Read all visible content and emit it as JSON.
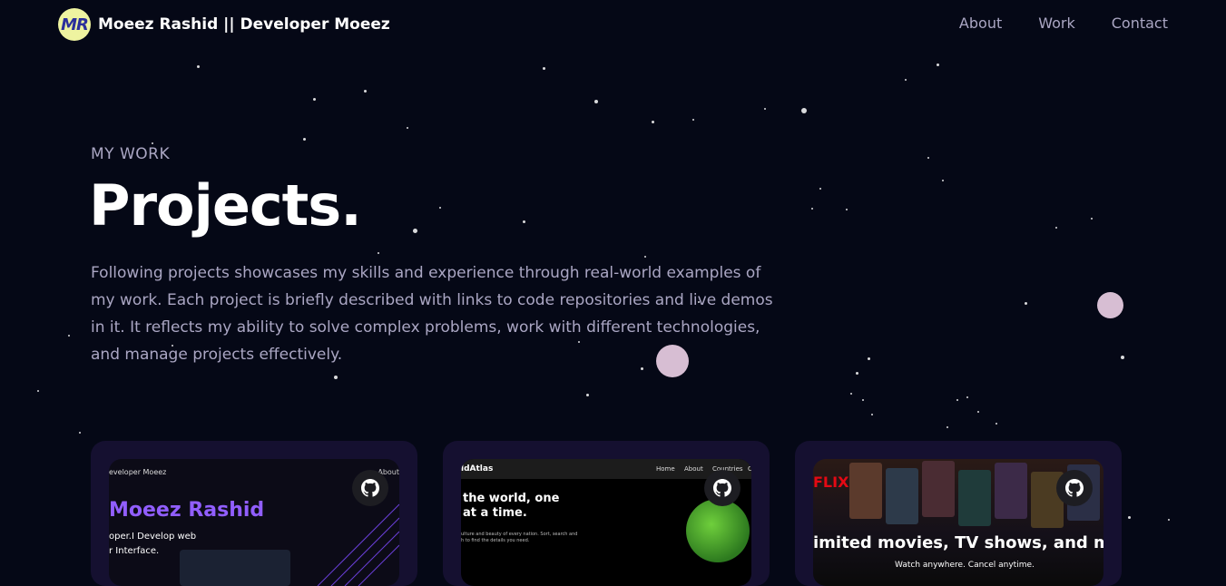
{
  "nav": {
    "logo_text": "MR",
    "brand": "Moeez Rashid || Developer Moeez",
    "links": [
      "About",
      "Work",
      "Contact"
    ]
  },
  "hero": {
    "kicker": "MY WORK",
    "title": "Projects.",
    "description": "Following projects showcases my skills and experience through real-world examples of my work. Each project is briefly described with links to code repositories and live demos in it. It reflects my ability to solve complex problems, work with different technologies, and manage projects effectively."
  },
  "projects": [
    {
      "github_icon": "github-icon",
      "preview": {
        "brand": "eveloper Moeez",
        "menu": "About",
        "name": "Moeez Rashid",
        "line1": "oper.I Develop web",
        "line2": "r Interface."
      }
    },
    {
      "github_icon": "github-icon",
      "preview": {
        "brand": "ldAtlas",
        "menu": [
          "Home",
          "About",
          "Countries",
          "C"
        ],
        "headline1": "the world, one",
        "headline2": "at a time.",
        "para": "ulture and beauty of every nation. Sort, search and h to find the details you need."
      }
    },
    {
      "github_icon": "github-icon",
      "preview": {
        "logo": "FLIX",
        "headline": "imited movies, TV shows, and m",
        "subline": "Watch anywhere. Cancel anytime."
      }
    }
  ],
  "colors": {
    "background": "#050816",
    "card": "#151030",
    "secondary_text": "#aaa6c3",
    "accent": "#915eff"
  }
}
